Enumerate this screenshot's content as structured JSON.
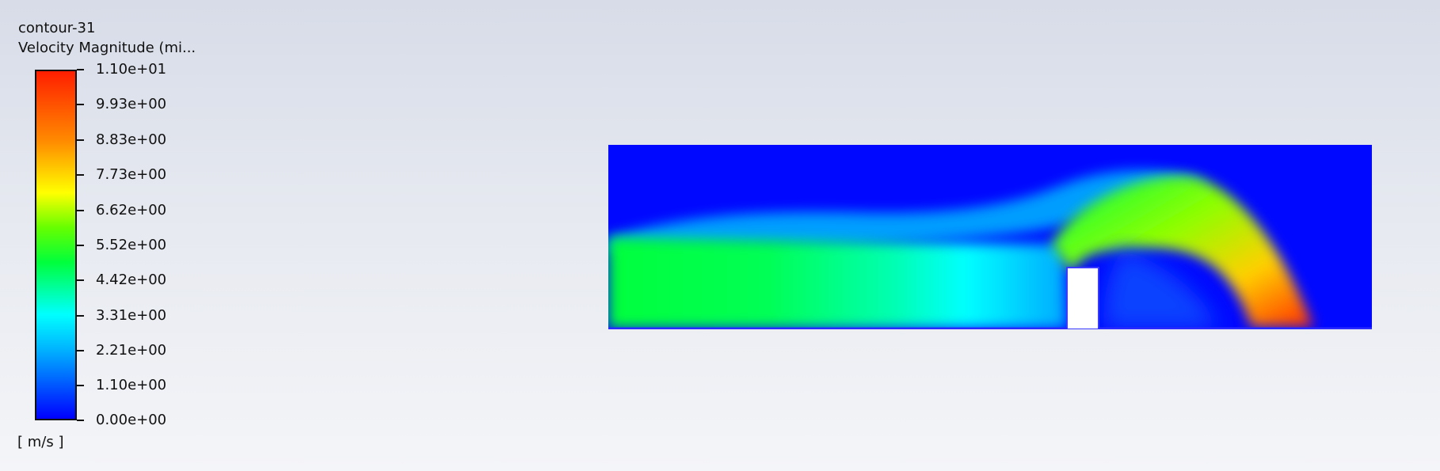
{
  "contour": {
    "name": "contour-31",
    "title": "Velocity Magnitude (mi...",
    "units": "[ m/s ]",
    "colormap": [
      "#0000ff",
      "#00b4ff",
      "#00ffff",
      "#00ff3c",
      "#66ff00",
      "#ffff00",
      "#ff8a00",
      "#ff1e00"
    ],
    "legend_values": [
      "1.10e+01",
      "9.93e+00",
      "8.83e+00",
      "7.73e+00",
      "6.62e+00",
      "5.52e+00",
      "4.42e+00",
      "3.31e+00",
      "2.21e+00",
      "1.10e+00",
      "0.00e+00"
    ]
  }
}
